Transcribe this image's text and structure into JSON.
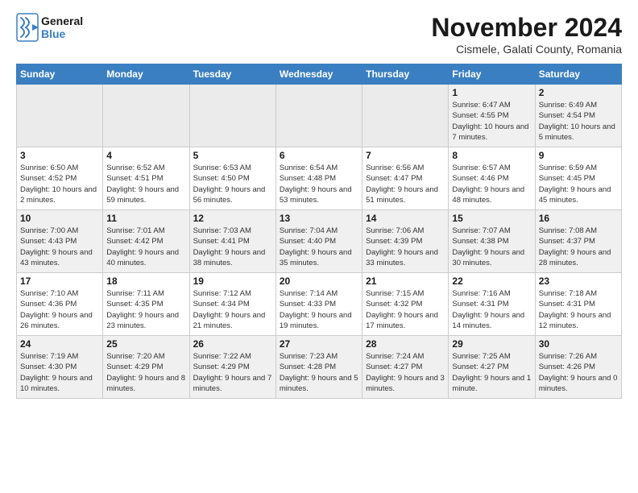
{
  "logo": {
    "line1": "General",
    "line2": "Blue"
  },
  "title": "November 2024",
  "location": "Cismele, Galati County, Romania",
  "weekdays": [
    "Sunday",
    "Monday",
    "Tuesday",
    "Wednesday",
    "Thursday",
    "Friday",
    "Saturday"
  ],
  "weeks": [
    [
      {
        "day": "",
        "info": ""
      },
      {
        "day": "",
        "info": ""
      },
      {
        "day": "",
        "info": ""
      },
      {
        "day": "",
        "info": ""
      },
      {
        "day": "",
        "info": ""
      },
      {
        "day": "1",
        "info": "Sunrise: 6:47 AM\nSunset: 4:55 PM\nDaylight: 10 hours and 7 minutes."
      },
      {
        "day": "2",
        "info": "Sunrise: 6:49 AM\nSunset: 4:54 PM\nDaylight: 10 hours and 5 minutes."
      }
    ],
    [
      {
        "day": "3",
        "info": "Sunrise: 6:50 AM\nSunset: 4:52 PM\nDaylight: 10 hours and 2 minutes."
      },
      {
        "day": "4",
        "info": "Sunrise: 6:52 AM\nSunset: 4:51 PM\nDaylight: 9 hours and 59 minutes."
      },
      {
        "day": "5",
        "info": "Sunrise: 6:53 AM\nSunset: 4:50 PM\nDaylight: 9 hours and 56 minutes."
      },
      {
        "day": "6",
        "info": "Sunrise: 6:54 AM\nSunset: 4:48 PM\nDaylight: 9 hours and 53 minutes."
      },
      {
        "day": "7",
        "info": "Sunrise: 6:56 AM\nSunset: 4:47 PM\nDaylight: 9 hours and 51 minutes."
      },
      {
        "day": "8",
        "info": "Sunrise: 6:57 AM\nSunset: 4:46 PM\nDaylight: 9 hours and 48 minutes."
      },
      {
        "day": "9",
        "info": "Sunrise: 6:59 AM\nSunset: 4:45 PM\nDaylight: 9 hours and 45 minutes."
      }
    ],
    [
      {
        "day": "10",
        "info": "Sunrise: 7:00 AM\nSunset: 4:43 PM\nDaylight: 9 hours and 43 minutes."
      },
      {
        "day": "11",
        "info": "Sunrise: 7:01 AM\nSunset: 4:42 PM\nDaylight: 9 hours and 40 minutes."
      },
      {
        "day": "12",
        "info": "Sunrise: 7:03 AM\nSunset: 4:41 PM\nDaylight: 9 hours and 38 minutes."
      },
      {
        "day": "13",
        "info": "Sunrise: 7:04 AM\nSunset: 4:40 PM\nDaylight: 9 hours and 35 minutes."
      },
      {
        "day": "14",
        "info": "Sunrise: 7:06 AM\nSunset: 4:39 PM\nDaylight: 9 hours and 33 minutes."
      },
      {
        "day": "15",
        "info": "Sunrise: 7:07 AM\nSunset: 4:38 PM\nDaylight: 9 hours and 30 minutes."
      },
      {
        "day": "16",
        "info": "Sunrise: 7:08 AM\nSunset: 4:37 PM\nDaylight: 9 hours and 28 minutes."
      }
    ],
    [
      {
        "day": "17",
        "info": "Sunrise: 7:10 AM\nSunset: 4:36 PM\nDaylight: 9 hours and 26 minutes."
      },
      {
        "day": "18",
        "info": "Sunrise: 7:11 AM\nSunset: 4:35 PM\nDaylight: 9 hours and 23 minutes."
      },
      {
        "day": "19",
        "info": "Sunrise: 7:12 AM\nSunset: 4:34 PM\nDaylight: 9 hours and 21 minutes."
      },
      {
        "day": "20",
        "info": "Sunrise: 7:14 AM\nSunset: 4:33 PM\nDaylight: 9 hours and 19 minutes."
      },
      {
        "day": "21",
        "info": "Sunrise: 7:15 AM\nSunset: 4:32 PM\nDaylight: 9 hours and 17 minutes."
      },
      {
        "day": "22",
        "info": "Sunrise: 7:16 AM\nSunset: 4:31 PM\nDaylight: 9 hours and 14 minutes."
      },
      {
        "day": "23",
        "info": "Sunrise: 7:18 AM\nSunset: 4:31 PM\nDaylight: 9 hours and 12 minutes."
      }
    ],
    [
      {
        "day": "24",
        "info": "Sunrise: 7:19 AM\nSunset: 4:30 PM\nDaylight: 9 hours and 10 minutes."
      },
      {
        "day": "25",
        "info": "Sunrise: 7:20 AM\nSunset: 4:29 PM\nDaylight: 9 hours and 8 minutes."
      },
      {
        "day": "26",
        "info": "Sunrise: 7:22 AM\nSunset: 4:29 PM\nDaylight: 9 hours and 7 minutes."
      },
      {
        "day": "27",
        "info": "Sunrise: 7:23 AM\nSunset: 4:28 PM\nDaylight: 9 hours and 5 minutes."
      },
      {
        "day": "28",
        "info": "Sunrise: 7:24 AM\nSunset: 4:27 PM\nDaylight: 9 hours and 3 minutes."
      },
      {
        "day": "29",
        "info": "Sunrise: 7:25 AM\nSunset: 4:27 PM\nDaylight: 9 hours and 1 minute."
      },
      {
        "day": "30",
        "info": "Sunrise: 7:26 AM\nSunset: 4:26 PM\nDaylight: 9 hours and 0 minutes."
      }
    ]
  ]
}
